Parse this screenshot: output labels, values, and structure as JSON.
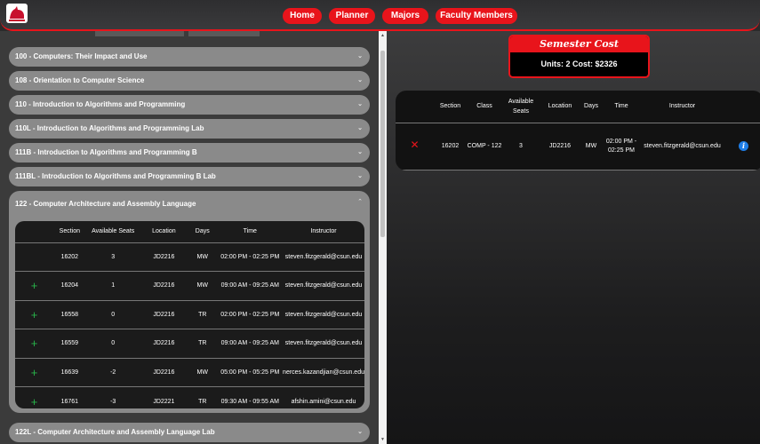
{
  "nav": {
    "home": "Home",
    "planner": "Planner",
    "majors": "Majors",
    "faculty": "Faculty Members"
  },
  "courses": [
    {
      "label": "100 - Computers: Their Impact and Use"
    },
    {
      "label": "108 - Orientation to Computer Science"
    },
    {
      "label": "110 - Introduction to Algorithms and Programming"
    },
    {
      "label": "110L - Introduction to Algorithms and Programming Lab"
    },
    {
      "label": "111B - Introduction to Algorithms and Programming B"
    },
    {
      "label": "111BL - Introduction to Algorithms and Programming B Lab"
    }
  ],
  "open_course": {
    "label": "122 - Computer Architecture and Assembly Language",
    "headers": [
      "Section",
      "Available Seats",
      "Location",
      "Days",
      "Time",
      "Instructor"
    ],
    "rows": [
      {
        "section": "16202",
        "seats": "3",
        "location": "JD2216",
        "days": "MW",
        "time": "02:00 PM - 02:25 PM",
        "instructor": "steven.fitzgerald@csun.edu",
        "added": true
      },
      {
        "section": "16204",
        "seats": "1",
        "location": "JD2216",
        "days": "MW",
        "time": "09:00 AM - 09:25 AM",
        "instructor": "steven.fitzgerald@csun.edu",
        "added": false
      },
      {
        "section": "16558",
        "seats": "0",
        "location": "JD2216",
        "days": "TR",
        "time": "02:00 PM - 02:25 PM",
        "instructor": "steven.fitzgerald@csun.edu",
        "added": false
      },
      {
        "section": "16559",
        "seats": "0",
        "location": "JD2216",
        "days": "TR",
        "time": "09:00 AM - 09:25 AM",
        "instructor": "steven.fitzgerald@csun.edu",
        "added": false
      },
      {
        "section": "16639",
        "seats": "-2",
        "location": "JD2216",
        "days": "MW",
        "time": "05:00 PM - 05:25 PM",
        "instructor": "nerces.kazandjian@csun.edu",
        "added": false
      },
      {
        "section": "16761",
        "seats": "-3",
        "location": "JD2221",
        "days": "TR",
        "time": "09:30 AM - 09:55 AM",
        "instructor": "afshin.amini@csun.edu",
        "added": false
      }
    ]
  },
  "next_course": {
    "label": "122L - Computer Architecture and Assembly Language Lab"
  },
  "cost": {
    "title": "Semester Cost",
    "summary": "Units: 2  Cost: $2326"
  },
  "schedule": {
    "headers": [
      "Section",
      "Class",
      "Available Seats",
      "Location",
      "Days",
      "Time",
      "Instructor"
    ],
    "rows": [
      {
        "section": "16202",
        "class": "COMP - 122",
        "seats": "3",
        "location": "JD2216",
        "days": "MW",
        "time": "02:00 PM - 02:25 PM",
        "instructor": "steven.fitzgerald@csun.edu"
      }
    ]
  },
  "colors": {
    "accent": "#e8141b",
    "add": "#28b44a",
    "info": "#1e7de6"
  }
}
